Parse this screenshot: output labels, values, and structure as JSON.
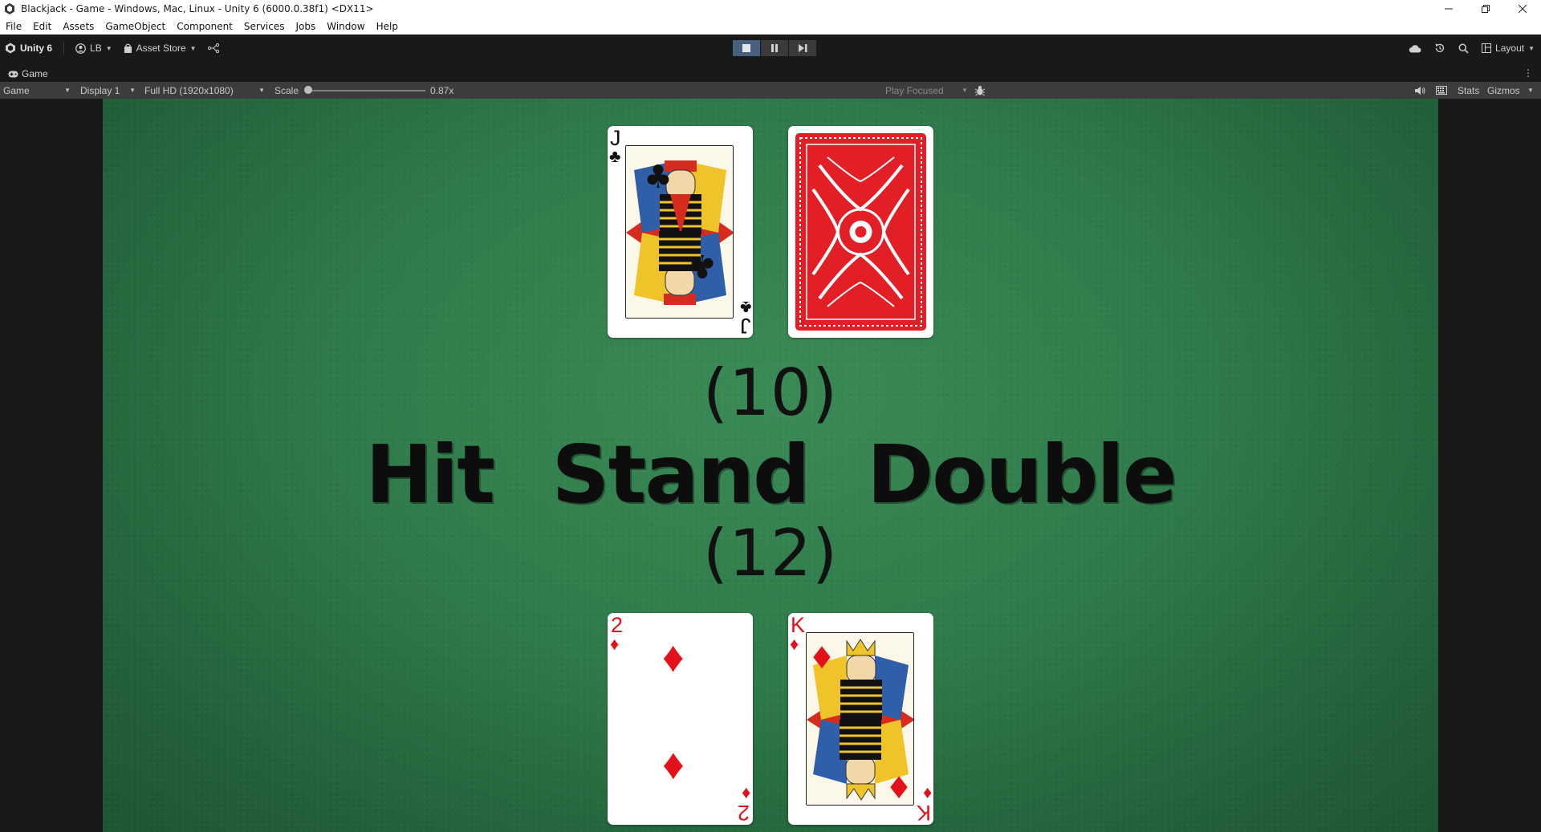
{
  "window": {
    "title": "Blackjack - Game - Windows, Mac, Linux - Unity 6 (6000.0.38f1) <DX11>",
    "controls": [
      "minimize",
      "restore",
      "close"
    ]
  },
  "menu": [
    "File",
    "Edit",
    "Assets",
    "GameObject",
    "Component",
    "Services",
    "Jobs",
    "Window",
    "Help"
  ],
  "toolbar": {
    "unity_label": "Unity 6",
    "account_label": "LB",
    "asset_store_label": "Asset Store",
    "layout_label": "Layout"
  },
  "tab": {
    "label": "Game"
  },
  "game_bar": {
    "view_mode": "Game",
    "display": "Display 1",
    "resolution": "Full HD (1920x1080)",
    "scale_label": "Scale",
    "scale_value": "0.87x",
    "play_mode": "Play Focused",
    "stats_label": "Stats",
    "gizmos_label": "Gizmos"
  },
  "game": {
    "dealer_cards": [
      {
        "rank": "J",
        "suit": "♣",
        "color": "black",
        "face_up": true
      },
      {
        "face_up": false
      }
    ],
    "dealer_score": "(10)",
    "actions": [
      "Hit",
      "Stand",
      "Double"
    ],
    "player_score": "(12)",
    "player_cards": [
      {
        "rank": "2",
        "suit": "♦",
        "color": "red",
        "face_up": true
      },
      {
        "rank": "K",
        "suit": "♦",
        "color": "red",
        "face_up": true
      }
    ]
  },
  "colors": {
    "felt": "#2f7a4a",
    "card_red": "#e3111a",
    "card_back": "#e21f27",
    "editor_dark": "#191919",
    "toolbar_gray": "#3c3c3c",
    "play_active": "#46607f"
  }
}
